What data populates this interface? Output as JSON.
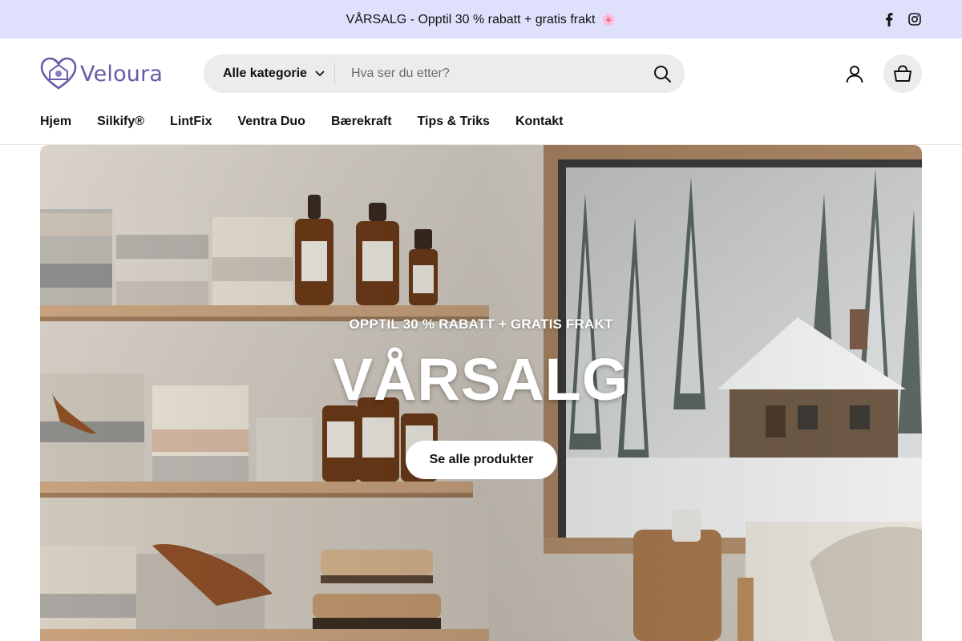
{
  "announcement": {
    "text": "VÅRSALG - Opptil 30 % rabatt + gratis frakt",
    "emoji": "🌸"
  },
  "social": {
    "icons": [
      "facebook-icon",
      "instagram-icon"
    ]
  },
  "brand": {
    "name": "Veloura",
    "accent_color": "#6a5aa8"
  },
  "search": {
    "category_label": "Alle kategorie",
    "placeholder": "Hva ser du etter?"
  },
  "nav": {
    "items": [
      "Hjem",
      "Silkify®",
      "LintFix",
      "Ventra Duo",
      "Bærekraft",
      "Tips & Triks",
      "Kontakt"
    ]
  },
  "hero": {
    "subtitle": "OPPTIL 30 % RABATT + GRATIS FRAKT",
    "title": "VÅRSALG",
    "button_label": "Se alle produkter"
  },
  "colors": {
    "announcement_bg": "#dfe0fb",
    "search_bg": "#ececec"
  }
}
